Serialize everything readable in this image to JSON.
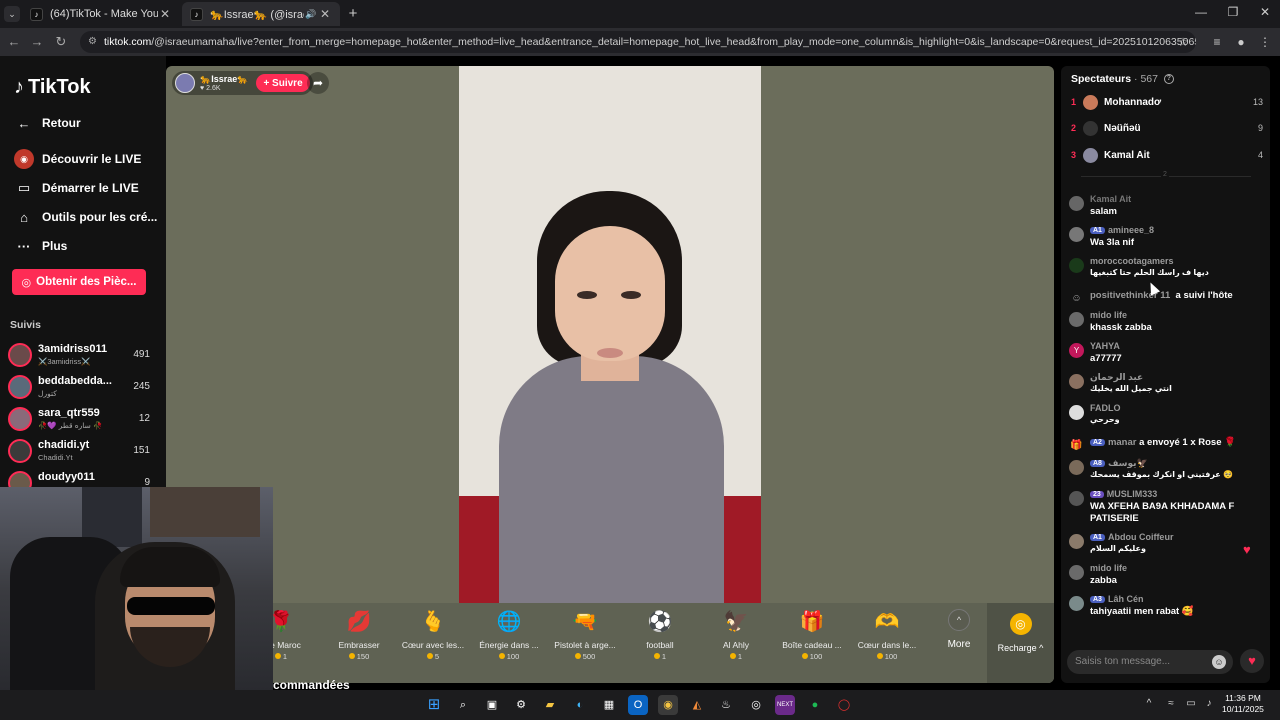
{
  "browser": {
    "tabs": [
      {
        "title": "(64)TikTok - Make Your Day",
        "active": false
      },
      {
        "title": "🐆Issrae🐆 (@israeumam...",
        "active": true
      }
    ],
    "url_host": "tiktok.com",
    "url_path": "/@israeumamaha/live?enter_from_merge=homepage_hot&enter_method=live_head&entrance_detail=homepage_hot_live_head&from_play_mode=one_column&is_highlight=0&is_landscape=0&request_id=2025101206350651A4FE7FD225BC4E1..."
  },
  "sidebar": {
    "logo": "TikTok",
    "back_label": "Retour",
    "items": [
      {
        "label": "Découvrir le LIVE",
        "icon": "live-avatar-icon"
      },
      {
        "label": "Démarrer le LIVE",
        "icon": "video-camera-icon"
      },
      {
        "label": "Outils pour les cré...",
        "icon": "house-icon"
      },
      {
        "label": "Plus",
        "icon": "more-dots-icon"
      }
    ],
    "coins_button": "Obtenir des Pièc...",
    "following_title": "Suivis",
    "following": [
      {
        "name": "3amidriss011",
        "sub": "⚔️3amiιdriss⚔️",
        "count": "491"
      },
      {
        "name": "beddabedda...",
        "sub": "ﻛﺘﻮﺭﻝ",
        "count": "245"
      },
      {
        "name": "sara_qtr559",
        "sub": "🥀💜 ﺳﺎﺭﻩ ﻗﻄﺮ 🥀",
        "count": "12"
      },
      {
        "name": "chadidi.yt",
        "sub": "Chadidi.Yt",
        "count": "151"
      },
      {
        "name": "doudyy011",
        "sub": "",
        "count": "9"
      }
    ]
  },
  "stream": {
    "host_name": "🐆Issrae🐆",
    "host_likes": "2.6K",
    "follow_label": "+ Suivre",
    "gifts": [
      {
        "name": "e le Maroc",
        "price": "1",
        "icon": "🌹"
      },
      {
        "name": "Embrasser",
        "price": "150",
        "icon": "💋"
      },
      {
        "name": "Cœur avec les...",
        "price": "5",
        "icon": "🫰"
      },
      {
        "name": "Énergie dans ...",
        "price": "100",
        "icon": "🌐"
      },
      {
        "name": "Pistolet à arge...",
        "price": "500",
        "icon": "🔫"
      },
      {
        "name": "football",
        "price": "1",
        "icon": "⚽"
      },
      {
        "name": "Al Ahly",
        "price": "1",
        "icon": "🦅"
      },
      {
        "name": "Boîte cadeau ...",
        "price": "100",
        "icon": "🎁"
      },
      {
        "name": "Cœur dans le...",
        "price": "100",
        "icon": "🫶"
      }
    ],
    "more_label": "More",
    "recharge_label": "Recharge ^",
    "recommended_heading": "commandées"
  },
  "chat": {
    "viewers_title": "Spectateurs",
    "viewers_count": "· 567",
    "top_viewers": [
      {
        "rank": "1",
        "name": "Mohannadơ",
        "score": "13"
      },
      {
        "rank": "2",
        "name": "Nəüñəü",
        "score": "9"
      },
      {
        "rank": "3",
        "name": "Kamal Ait",
        "score": "4"
      }
    ],
    "divider_label": "2",
    "messages": [
      {
        "user": "Kamal Ait",
        "badge": "",
        "text": "salam"
      },
      {
        "user": "amineee_8",
        "badge": "A1",
        "text": "Wa 3la nif"
      },
      {
        "user": "moroccootagamers",
        "badge": "",
        "text": "ديها ف راسك الحلم حتا كتبغيها"
      },
      {
        "user": "positivethinker 11",
        "badge": "",
        "text": "a suivi l'hôte",
        "system": true
      },
      {
        "user": "mido life",
        "badge": "",
        "text": "khassk zabba"
      },
      {
        "user": "YAHYA",
        "badge": "",
        "text": "a77777"
      },
      {
        "user": "عبد الرحمان",
        "badge": "",
        "text": "انتي جميل الله يخليك"
      },
      {
        "user": "FADLO",
        "badge": "",
        "text": "وحرحي"
      },
      {
        "user": "manar",
        "badge": "A2",
        "text": "a envoyé 1 x Rose 🌹",
        "system": true
      },
      {
        "user": "يوسف🦅",
        "badge": "A8",
        "text": "عرفتيني او انكرك بموقف يسمحك 🥺"
      },
      {
        "user": "MUSLIM333",
        "badge": "23",
        "text": "WA XFEHA BA9A KHHADAMA F PATISERIE"
      },
      {
        "user": "Abdou Coiffeur",
        "badge": "A1",
        "text": "وعليكم السلام"
      },
      {
        "user": "mido life",
        "badge": "",
        "text": "zabba"
      },
      {
        "user": "Lâh Cén",
        "badge": "A3",
        "text": "tahiyaatii men rabat 🥰"
      }
    ],
    "input_placeholder": "Saisis ton message..."
  },
  "taskbar": {
    "time": "11:36 PM",
    "date": "10/11/2025"
  },
  "colors": {
    "brand": "#fe2c55",
    "stage_bg": "#6b6d5b",
    "panel_bg": "#121212"
  }
}
